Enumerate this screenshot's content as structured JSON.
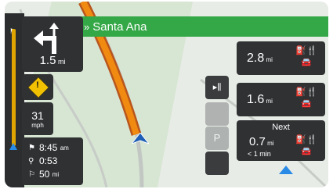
{
  "street_name": "Santa Ana",
  "street_prefix": "»",
  "turn": {
    "distance": "1.5",
    "unit": "mi"
  },
  "sidebar": {
    "flag_icon": "flag-icon"
  },
  "warning": {
    "icon": "warning-diamond-icon",
    "symbol": "!"
  },
  "speed": {
    "value": "31",
    "unit": "mph"
  },
  "trip": {
    "eta": "8:45",
    "eta_suffix": "am",
    "duration": "0:53",
    "remaining": "50",
    "remaining_unit": "mi"
  },
  "services": [
    {
      "distance": "2.8",
      "unit": "mi",
      "icons": "fuel, restaurant, car"
    },
    {
      "distance": "1.6",
      "unit": "mi",
      "icons": "fuel, restaurant, car"
    }
  ],
  "next": {
    "label": "Next",
    "distance": "0.7",
    "unit": "mi",
    "time": "< 1 min",
    "icons": "fuel, restaurant, car"
  },
  "lane_button": "lane-guidance-icon",
  "colors": {
    "accent": "#34a746",
    "panel": "#2f3133",
    "route": "#f08a10",
    "position": "#2a8be6"
  }
}
